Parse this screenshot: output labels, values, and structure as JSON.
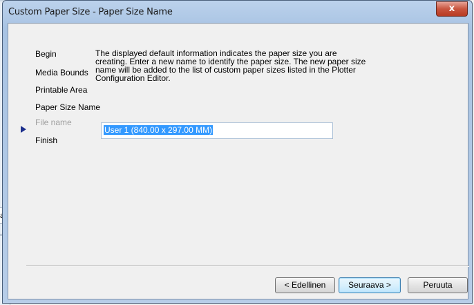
{
  "window": {
    "title": "Custom Paper Size - Paper Size Name",
    "close_symbol": "x"
  },
  "background": {
    "tab_text": "a"
  },
  "steps": [
    {
      "label": "Begin",
      "state": "done"
    },
    {
      "label": "Media Bounds",
      "state": "done"
    },
    {
      "label": "Printable Area",
      "state": "done"
    },
    {
      "label": "Paper Size Name",
      "state": "current"
    },
    {
      "label": "File name",
      "state": "disabled"
    },
    {
      "label": "Finish",
      "state": "pending"
    }
  ],
  "description": "The displayed default information indicates the paper size you are creating. Enter a new name to identify the paper size. The new paper size name will be added to the list of custom paper sizes listed in the Plotter Configuration Editor.",
  "paper_name": {
    "value": "User 1 (840.00 x 297.00 MM)",
    "selected": true
  },
  "buttons": {
    "back": "< Edellinen",
    "next": "Seuraava >",
    "cancel": "Peruuta"
  },
  "colors": {
    "current_step_arrow": "#1c2f8c",
    "selection": "#3399ff",
    "close_button": "#c9553f"
  }
}
